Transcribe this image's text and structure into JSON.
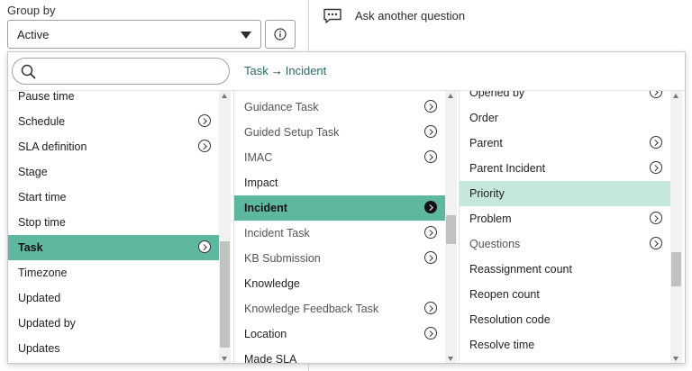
{
  "group_by": {
    "label": "Group by",
    "selected": "Active"
  },
  "ask": {
    "label": "Ask another question"
  },
  "search": {
    "placeholder": "",
    "value": ""
  },
  "breadcrumb": {
    "from": "Task",
    "arrow": "→",
    "to": "Incident"
  },
  "column1": {
    "items": [
      {
        "label": "Pause time",
        "chevron": false
      },
      {
        "label": "Schedule",
        "chevron": true
      },
      {
        "label": "SLA definition",
        "chevron": true
      },
      {
        "label": "Stage",
        "chevron": false
      },
      {
        "label": "Start time",
        "chevron": false
      },
      {
        "label": "Stop time",
        "chevron": false
      },
      {
        "label": "Task",
        "chevron": true,
        "state": "selected"
      },
      {
        "label": "Timezone",
        "chevron": false
      },
      {
        "label": "Updated",
        "chevron": false
      },
      {
        "label": "Updated by",
        "chevron": false
      },
      {
        "label": "Updates",
        "chevron": false
      }
    ]
  },
  "column2": {
    "items": [
      {
        "label": "Guidance Task",
        "chevron": true,
        "muted": true
      },
      {
        "label": "Guided Setup Task",
        "chevron": true,
        "muted": true
      },
      {
        "label": "IMAC",
        "chevron": true,
        "muted": true
      },
      {
        "label": "Impact",
        "chevron": false
      },
      {
        "label": "Incident",
        "chevron": true,
        "state": "selected"
      },
      {
        "label": "Incident Task",
        "chevron": true,
        "muted": true
      },
      {
        "label": "KB Submission",
        "chevron": true,
        "muted": true
      },
      {
        "label": "Knowledge",
        "chevron": false
      },
      {
        "label": "Knowledge Feedback Task",
        "chevron": true,
        "muted": true
      },
      {
        "label": "Location",
        "chevron": true
      },
      {
        "label": "Made SLA",
        "chevron": false
      }
    ]
  },
  "column3": {
    "items": [
      {
        "label": "Opened by",
        "chevron": true
      },
      {
        "label": "Order",
        "chevron": false
      },
      {
        "label": "Parent",
        "chevron": true
      },
      {
        "label": "Parent Incident",
        "chevron": true
      },
      {
        "label": "Priority",
        "chevron": false,
        "state": "highlighted"
      },
      {
        "label": "Problem",
        "chevron": true
      },
      {
        "label": "Questions",
        "chevron": true,
        "muted": true
      },
      {
        "label": "Reassignment count",
        "chevron": false
      },
      {
        "label": "Reopen count",
        "chevron": false
      },
      {
        "label": "Resolution code",
        "chevron": false
      },
      {
        "label": "Resolve time",
        "chevron": false
      }
    ]
  },
  "icons": {
    "info": "info-icon",
    "chat": "chat-bubble-icon",
    "search": "search-icon",
    "chevron": "chevron-right-circle-icon",
    "caret": "caret-down-icon"
  },
  "colors": {
    "selected": "#5eb8a0",
    "highlight": "#c6e7dc",
    "breadcrumb": "#2a6b62"
  }
}
